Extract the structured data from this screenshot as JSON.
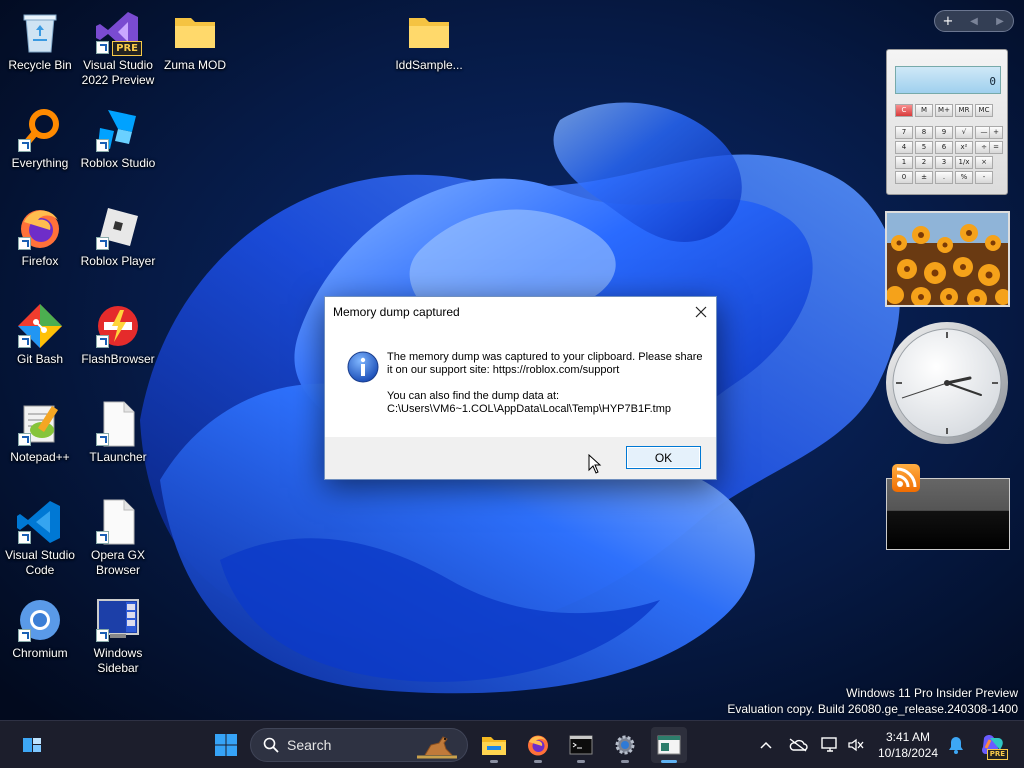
{
  "desktop": {
    "icons": [
      {
        "label": "Recycle Bin"
      },
      {
        "label": "Visual Studio 2022 Preview",
        "badge": "PRE"
      },
      {
        "label": "Zuma MOD"
      },
      {
        "label": "IddSample..."
      },
      {
        "label": "Everything"
      },
      {
        "label": "Roblox Studio"
      },
      {
        "label": "Firefox"
      },
      {
        "label": "Roblox Player"
      },
      {
        "label": "Git Bash"
      },
      {
        "label": "FlashBrowser"
      },
      {
        "label": "Notepad++"
      },
      {
        "label": "TLauncher"
      },
      {
        "label": "Visual Studio Code"
      },
      {
        "label": "Opera GX Browser"
      },
      {
        "label": "Chromium"
      },
      {
        "label": "Windows Sidebar"
      }
    ]
  },
  "gadgets": {
    "toolbar": {
      "add": "+",
      "prev": "◀",
      "next": "▶"
    },
    "calculator": {
      "display": "0",
      "memory_keys": [
        "C",
        "M",
        "M+",
        "MR",
        "MC"
      ],
      "rows": [
        [
          "7",
          "8",
          "9",
          "√",
          "—"
        ],
        [
          "4",
          "5",
          "6",
          "x²",
          "÷"
        ],
        [
          "1",
          "2",
          "3",
          "1/x",
          "×"
        ],
        [
          "0",
          "±",
          ".",
          "%",
          "-"
        ]
      ],
      "side_keys": [
        "+",
        "="
      ]
    }
  },
  "watermark": {
    "line1": "Windows 11 Pro Insider Preview",
    "line2": "Evaluation copy. Build 26080.ge_release.240308-1400"
  },
  "dialog": {
    "title": "Memory dump captured",
    "line1": "The memory dump was captured to your clipboard. Please share it on our support site: https://roblox.com/support",
    "line2": "You can also find the dump data at:",
    "path": "C:\\Users\\VM6~1.COL\\AppData\\Local\\Temp\\HYP7B1F.tmp",
    "ok_label": "OK"
  },
  "taskbar": {
    "search_placeholder": "Search",
    "time": "3:41 AM",
    "date": "10/18/2024",
    "copilot_badge": "PRE"
  },
  "colors": {
    "accent": "#0078d4",
    "taskbar": "#1c1e2c",
    "wallpaper_blue": "#1f5cff"
  }
}
